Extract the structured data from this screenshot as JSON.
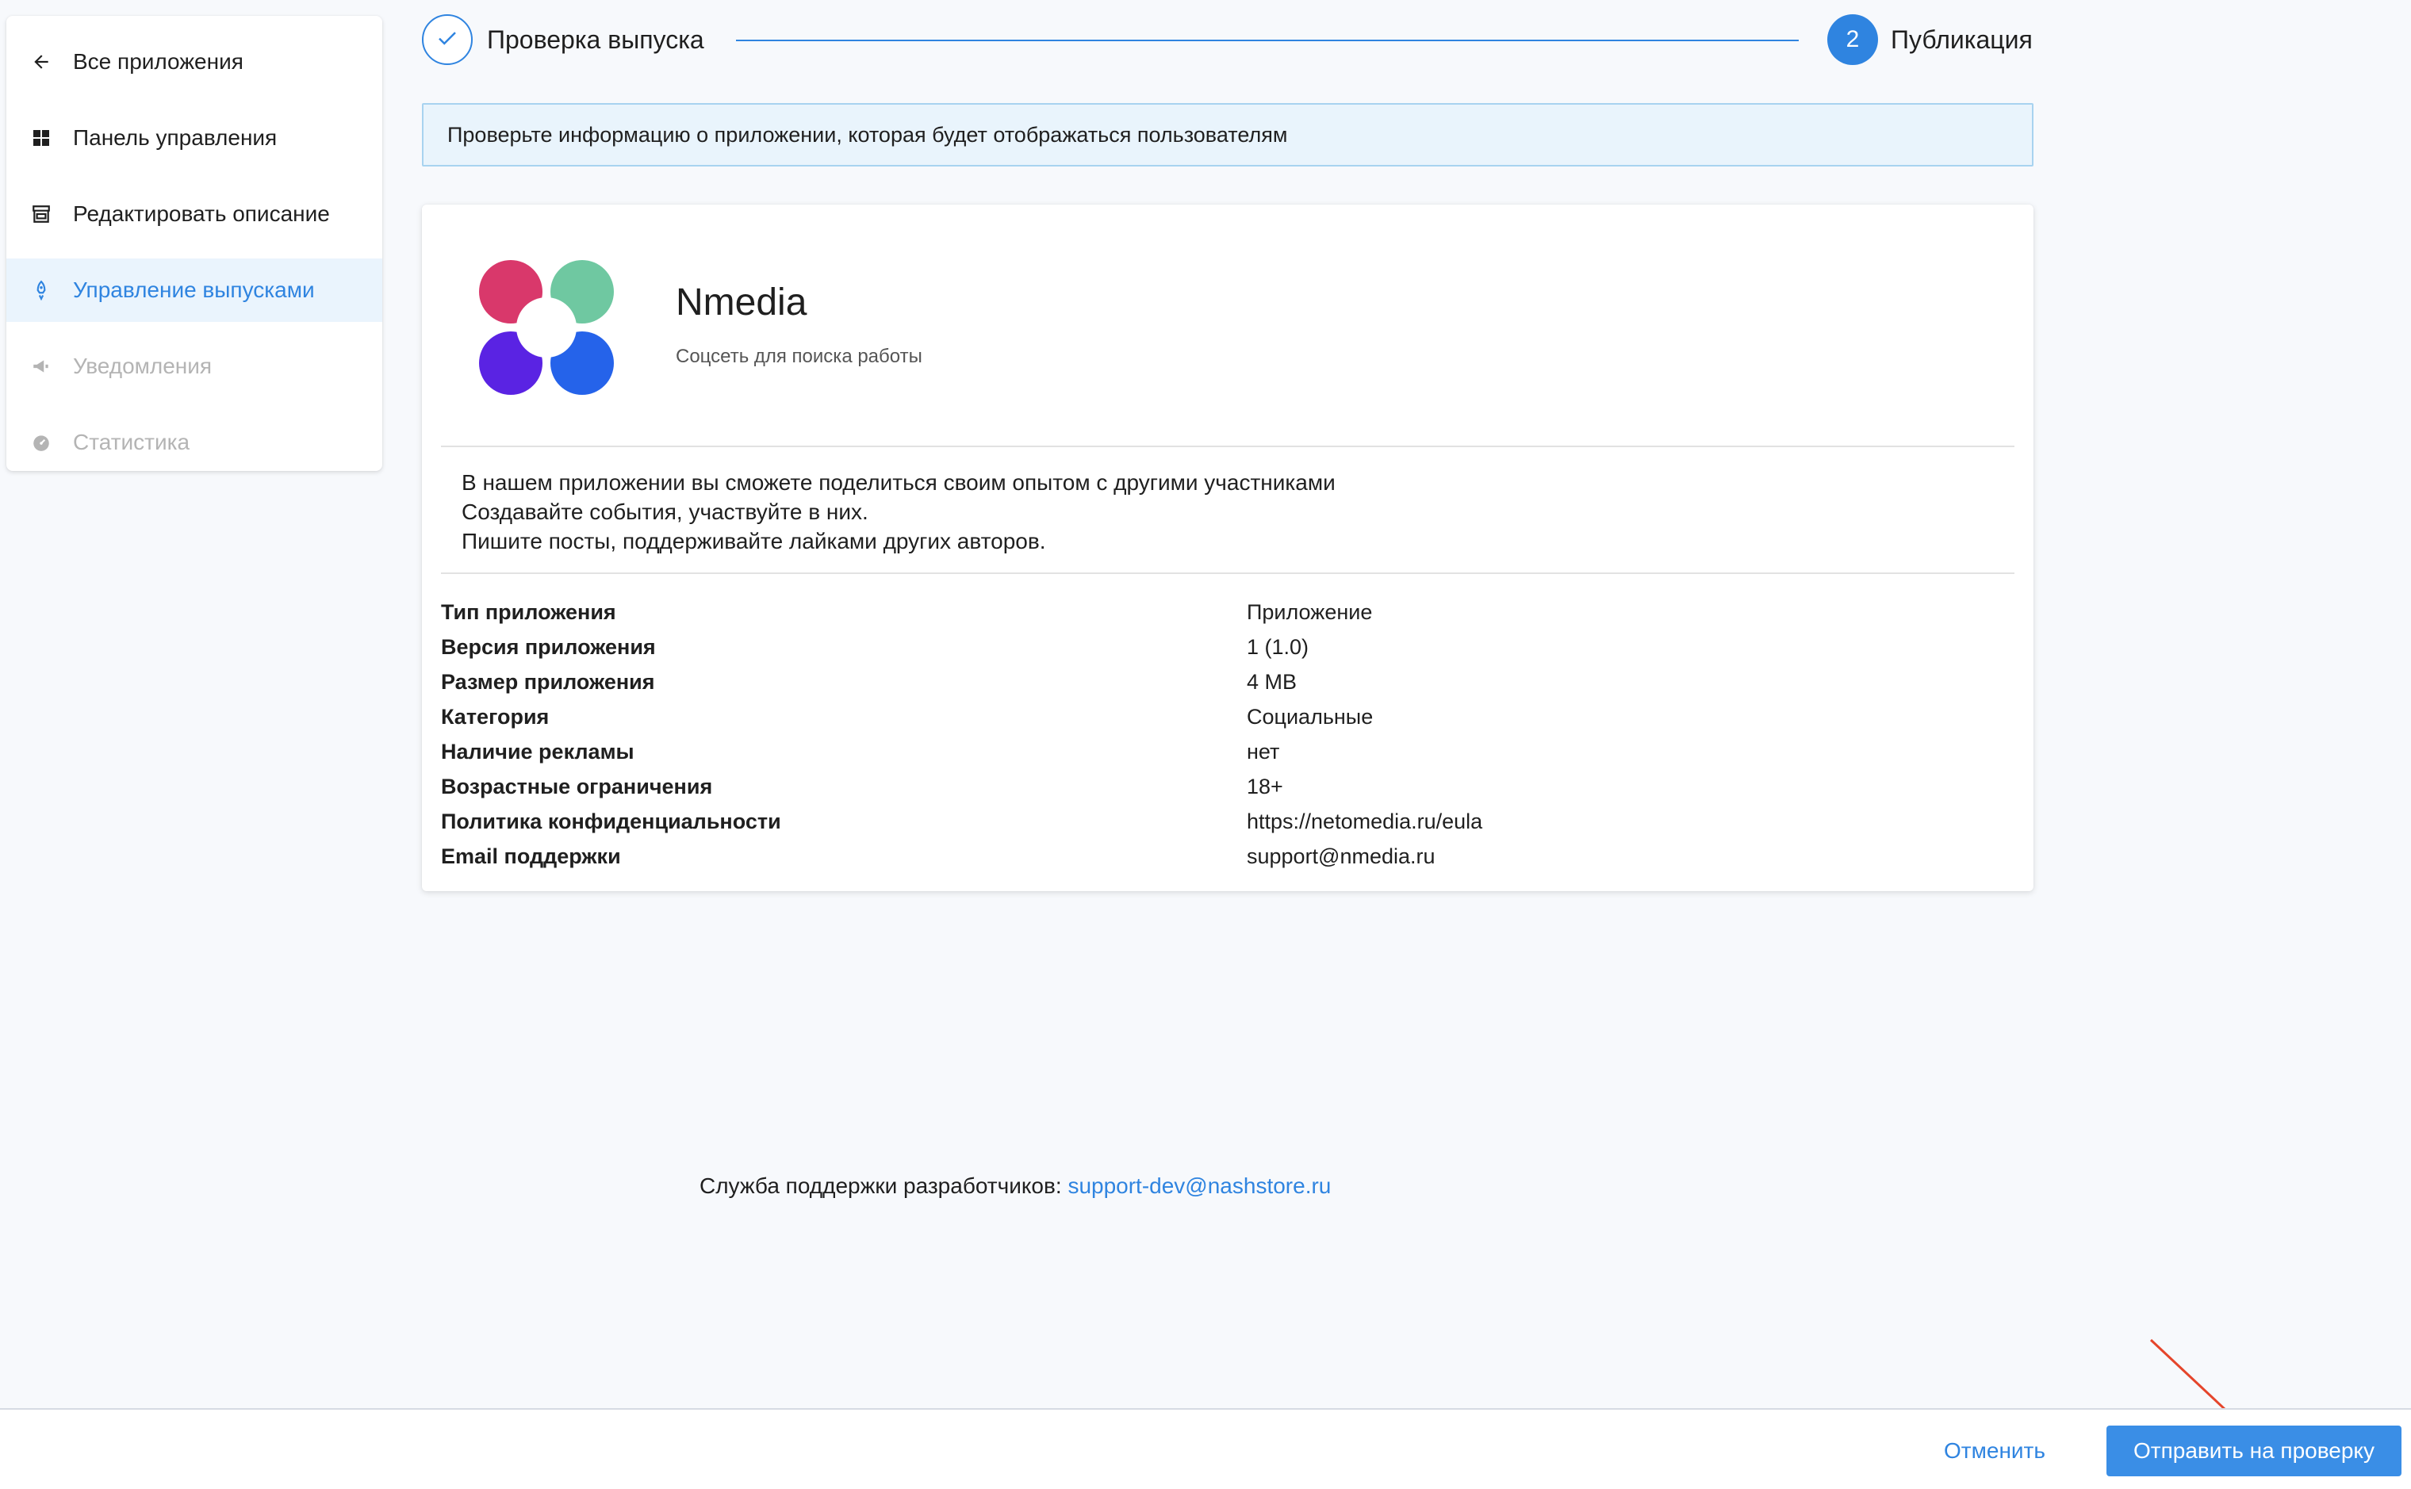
{
  "sidebar": {
    "items": [
      {
        "label": "Все приложения",
        "icon": "arrow-left-icon",
        "state": "normal"
      },
      {
        "label": "Панель управления",
        "icon": "dashboard-grid-icon",
        "state": "normal"
      },
      {
        "label": "Редактировать описание",
        "icon": "storefront-icon",
        "state": "normal"
      },
      {
        "label": "Управление выпусками",
        "icon": "rocket-icon",
        "state": "active"
      },
      {
        "label": "Уведомления",
        "icon": "megaphone-icon",
        "state": "disabled"
      },
      {
        "label": "Статистика",
        "icon": "speedometer-icon",
        "state": "disabled"
      }
    ]
  },
  "stepper": {
    "step1_label": "Проверка выпуска",
    "step2_number": "2",
    "step2_label": "Публикация"
  },
  "banner": {
    "text": "Проверьте информацию о приложении, которая будет отображаться пользователям"
  },
  "app": {
    "name": "Nmedia",
    "subtitle": "Соцсеть для поиска работы",
    "description": [
      "В нашем приложении вы сможете поделиться своим опытом с другими участниками",
      "Создавайте события, участвуйте в них.",
      "Пишите посты, поддерживайте лайками других авторов."
    ],
    "details": [
      {
        "key": "Тип приложения",
        "value": "Приложение"
      },
      {
        "key": "Версия приложения",
        "value": "1 (1.0)"
      },
      {
        "key": "Размер приложения",
        "value": "4 MB"
      },
      {
        "key": "Категория",
        "value": "Социальные"
      },
      {
        "key": "Наличие рекламы",
        "value": "нет"
      },
      {
        "key": "Возрастные ограничения",
        "value": "18+"
      },
      {
        "key": "Политика конфиденциальности",
        "value": "https://netomedia.ru/eula"
      },
      {
        "key": "Email поддержки",
        "value": "support@nmedia.ru"
      }
    ]
  },
  "footer": {
    "support_label": "Служба поддержки разработчиков: ",
    "support_email": "support-dev@nashstore.ru"
  },
  "actions": {
    "cancel_label": "Отменить",
    "submit_label": "Отправить на проверку"
  },
  "colors": {
    "accent": "#2f84e0",
    "banner_bg": "#e9f4fc",
    "page_bg": "#f7f9fc",
    "annotation_arrow": "#e5452b"
  }
}
